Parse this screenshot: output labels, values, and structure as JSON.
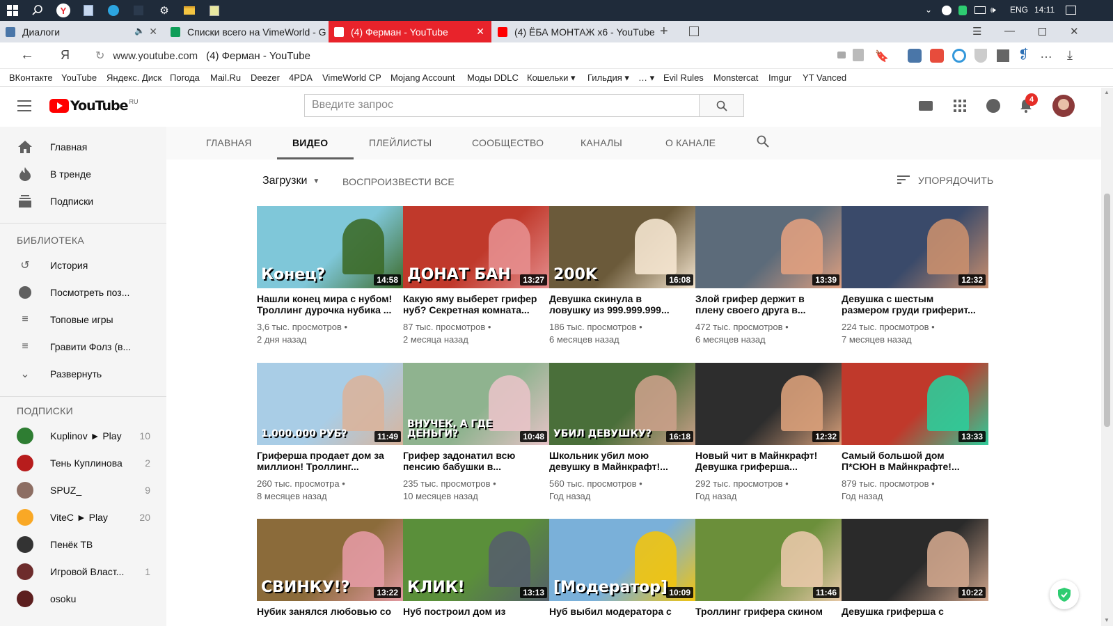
{
  "taskbar": {
    "lang": "ENG",
    "time": "14:11"
  },
  "tabs": [
    {
      "title": "Диалоги",
      "color": "#4a76a8"
    },
    {
      "title": "Списки всего на VimeWorld - G",
      "color": "#0f9d58"
    },
    {
      "title": "(4) Ферман - YouTube",
      "color": "#ff0000"
    },
    {
      "title": "(4) ЁБА МОНТАЖ х6 - YouTube",
      "color": "#ff0000"
    }
  ],
  "address": {
    "url": "www.youtube.com",
    "title": "(4) Ферман - YouTube",
    "yandex_label": "Я"
  },
  "bookmarks": [
    "ВКонтакте",
    "YouTube",
    "Яндекс. Диск",
    "Погода",
    "Mail.Ru",
    "Deezer",
    "4PDA",
    "VimeWorld CP",
    "Mojang Account",
    "Моды DDLC",
    "Кошельки ▾",
    "Гильдия ▾",
    "… ▾",
    "Evil Rules",
    "Monstercat",
    "Imgur",
    "YT Vanced"
  ],
  "yt": {
    "logo_text": "YouTube",
    "logo_region": "RU",
    "search_placeholder": "Введите запрос",
    "notif_count": "4"
  },
  "sidebar": {
    "main": [
      "Главная",
      "В тренде",
      "Подписки"
    ],
    "library_head": "БИБЛИОТЕКА",
    "library": [
      "История",
      "Посмотреть поз...",
      "Топовые игры",
      "Гравити Фолз (в...",
      "Развернуть"
    ],
    "subs_head": "ПОДПИСКИ",
    "subs": [
      {
        "name": "Kuplinov ► Play",
        "count": "10",
        "color": "#2e7d32"
      },
      {
        "name": "Тень Куплинова",
        "count": "2",
        "color": "#b71c1c"
      },
      {
        "name": "SPUZ_",
        "count": "9",
        "color": "#8d6e63"
      },
      {
        "name": "ViteC ► Play",
        "count": "20",
        "color": "#f9a825"
      },
      {
        "name": "Пенёк ТВ",
        "count": "",
        "color": "#333333"
      },
      {
        "name": "Игровой Власт...",
        "count": "1",
        "color": "#6d2c2c"
      },
      {
        "name": "osoku",
        "count": "",
        "color": "#5d1f1f"
      }
    ]
  },
  "channel_tabs": [
    "ГЛАВНАЯ",
    "ВИДЕО",
    "ПЛЕЙЛИСТЫ",
    "СООБЩЕСТВО",
    "КАНАЛЫ",
    "О КАНАЛЕ"
  ],
  "toolbar": {
    "uploads": "Загрузки",
    "play_all": "ВОСПРОИЗВЕСТИ ВСЕ",
    "sort": "УПОРЯДОЧИТЬ"
  },
  "videos": [
    {
      "t1": "Нашли конец мира с нубом!",
      "t2": "Троллинг дурочка нубика ...",
      "views": "3,6 тыс. просмотров •",
      "age": "2 дня назад",
      "dur": "14:58",
      "overlay": "Конец?",
      "bg": "#7fc7d9",
      "c2": "#3d6b2a"
    },
    {
      "t1": "Какую яму выберет грифер",
      "t2": "нуб? Секретная комната...",
      "views": "87 тыс. просмотров •",
      "age": "2 месяца назад",
      "dur": "13:27",
      "overlay": "ДОНАТ  БАН",
      "bg": "#c0392b",
      "c2": "#e58e8e"
    },
    {
      "t1": "Девушка скинула в",
      "t2": "ловушку из 999.999.999...",
      "views": "186 тыс. просмотров •",
      "age": "6 месяцев назад",
      "dur": "16:08",
      "overlay": "200K",
      "bg": "#6b5a3a",
      "c2": "#f5e6d0"
    },
    {
      "t1": "Злой грифер держит в",
      "t2": "плену своего друга в...",
      "views": "472 тыс. просмотров •",
      "age": "6 месяцев назад",
      "dur": "13:39",
      "overlay": "",
      "bg": "#5c6b7a",
      "c2": "#e0a080"
    },
    {
      "t1": "Девушка с шестым",
      "t2": "размером груди гриферит...",
      "views": "224 тыс. просмотров •",
      "age": "7 месяцев назад",
      "dur": "12:32",
      "overlay": "",
      "bg": "#3a4a6a",
      "c2": "#c98f6e"
    },
    {
      "t1": "Гриферша продает дом за",
      "t2": "миллион! Троллинг...",
      "views": "260 тыс. просмотра •",
      "age": "8 месяцев назад",
      "dur": "11:49",
      "overlay": "1.000.000 РУБ?",
      "bg": "#a9cde6",
      "c2": "#d9b49c"
    },
    {
      "t1": "Грифер задонатил всю",
      "t2": "пенсию бабушки в...",
      "views": "235 тыс. просмотров •",
      "age": "10 месяцев назад",
      "dur": "10:48",
      "overlay": "ВНУЧЕК, А ГДЕ ДЕНЬГИ?",
      "bg": "#8fb38f",
      "c2": "#e8c3c8"
    },
    {
      "t1": "Школьник убил мою",
      "t2": "девушку в Майнкрафт!...",
      "views": "560 тыс. просмотров •",
      "age": "Год назад",
      "dur": "16:18",
      "overlay": "УБИЛ ДЕВУШКУ?",
      "bg": "#4a6f3a",
      "c2": "#caa089"
    },
    {
      "t1": "Новый чит в Майнкрафт!",
      "t2": "Девушка гриферша...",
      "views": "292 тыс. просмотров •",
      "age": "Год назад",
      "dur": "12:32",
      "overlay": "",
      "bg": "#2d2d2d",
      "c2": "#d9a07a"
    },
    {
      "t1": "Самый большой дом",
      "t2": "П*СЮН в Майнкрафте!...",
      "views": "879 тыс. просмотров •",
      "age": "Год назад",
      "dur": "13:33",
      "overlay": "",
      "bg": "#c0392b",
      "c2": "#2ecc9a"
    },
    {
      "t1": "Нубик занялся любовью со",
      "t2": "",
      "views": "",
      "age": "",
      "dur": "13:22",
      "overlay": "СВИНКУ!?",
      "bg": "#8b6b3a",
      "c2": "#e39aa3"
    },
    {
      "t1": "Нуб построил дом из",
      "t2": "",
      "views": "",
      "age": "",
      "dur": "13:13",
      "overlay": "КЛИК!",
      "bg": "#5a8f3a",
      "c2": "#555f6a"
    },
    {
      "t1": "Нуб выбил модератора с",
      "t2": "",
      "views": "",
      "age": "",
      "dur": "10:09",
      "overlay": "[Модератор]",
      "bg": "#7ab0d9",
      "c2": "#f1c40f"
    },
    {
      "t1": "Троллинг грифера скином",
      "t2": "",
      "views": "",
      "age": "",
      "dur": "11:46",
      "overlay": "",
      "bg": "#6b8f3a",
      "c2": "#e8c8a8"
    },
    {
      "t1": "Девушка гриферша с",
      "t2": "",
      "views": "",
      "age": "",
      "dur": "10:22",
      "overlay": "",
      "bg": "#2a2a2a",
      "c2": "#cfa58c"
    }
  ]
}
